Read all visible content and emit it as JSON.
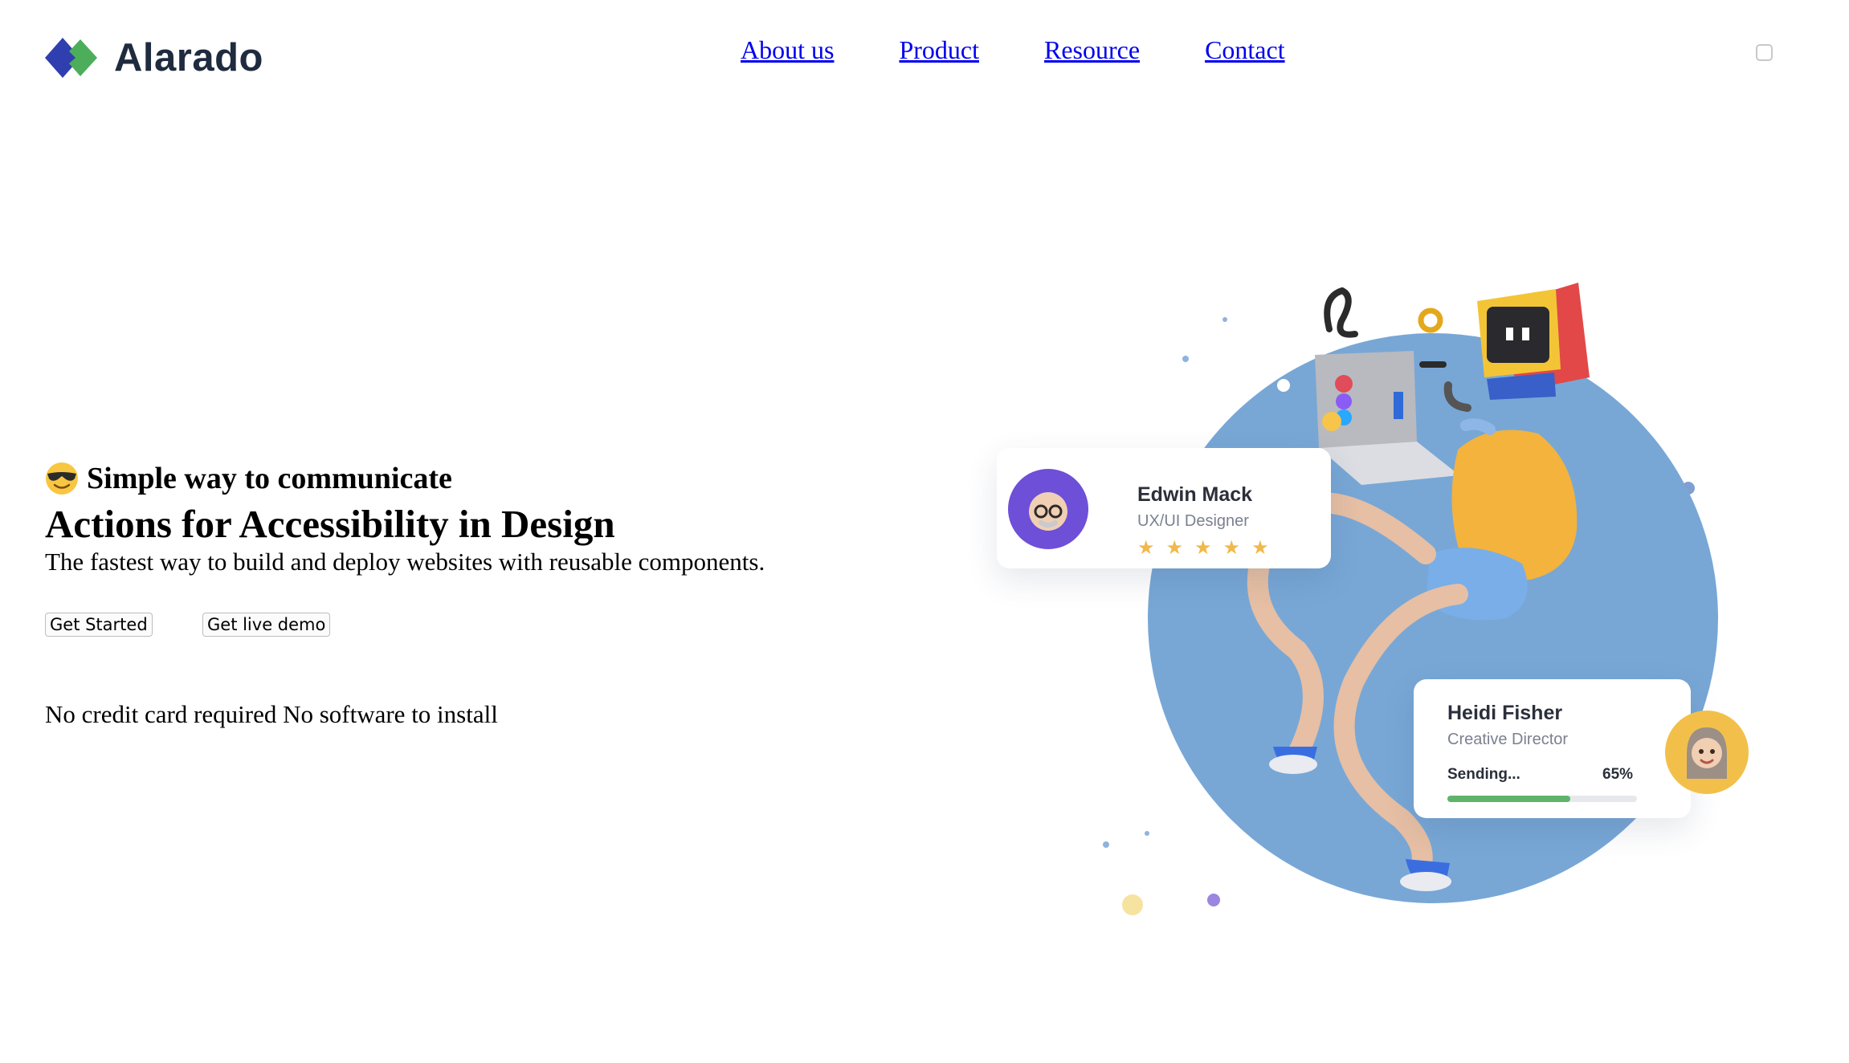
{
  "brand": {
    "name": "Alarado",
    "colors": {
      "mark_primary": "#2f3fb0",
      "mark_secondary": "#4cae5b",
      "text": "#1f2b3e"
    }
  },
  "nav": {
    "links": [
      {
        "label": "About us"
      },
      {
        "label": "Product"
      },
      {
        "label": "Resource"
      },
      {
        "label": "Contact"
      }
    ],
    "link_color": "#0000ee",
    "menu_icon": "menu-toggle-checkbox"
  },
  "hero": {
    "tagline_icon": "smiling-face-with-sunglasses-icon",
    "tagline": "Simple way to communicate",
    "headline": "Actions for Accessibility in Design",
    "subtext": "The fastest way to build and deploy websites with reusable components.",
    "primary_button": "Get Started",
    "secondary_button": "Get live demo",
    "note": "No credit card required No software to install"
  },
  "illustration": {
    "circle_color": "#78a7d6",
    "profile_card": {
      "name": "Edwin Mack",
      "role": "UX/UI Designer",
      "rating": 5,
      "avatar_color": "#6e4fd8",
      "star_color": "#f1b84b"
    },
    "progress_card": {
      "name": "Heidi Fisher",
      "role": "Creative Director",
      "progress_label": "Sending...",
      "progress_percent": "65%",
      "progress_value": 0.65,
      "progress_color": "#5fb46a",
      "avatar_color": "#f2c04a"
    }
  }
}
